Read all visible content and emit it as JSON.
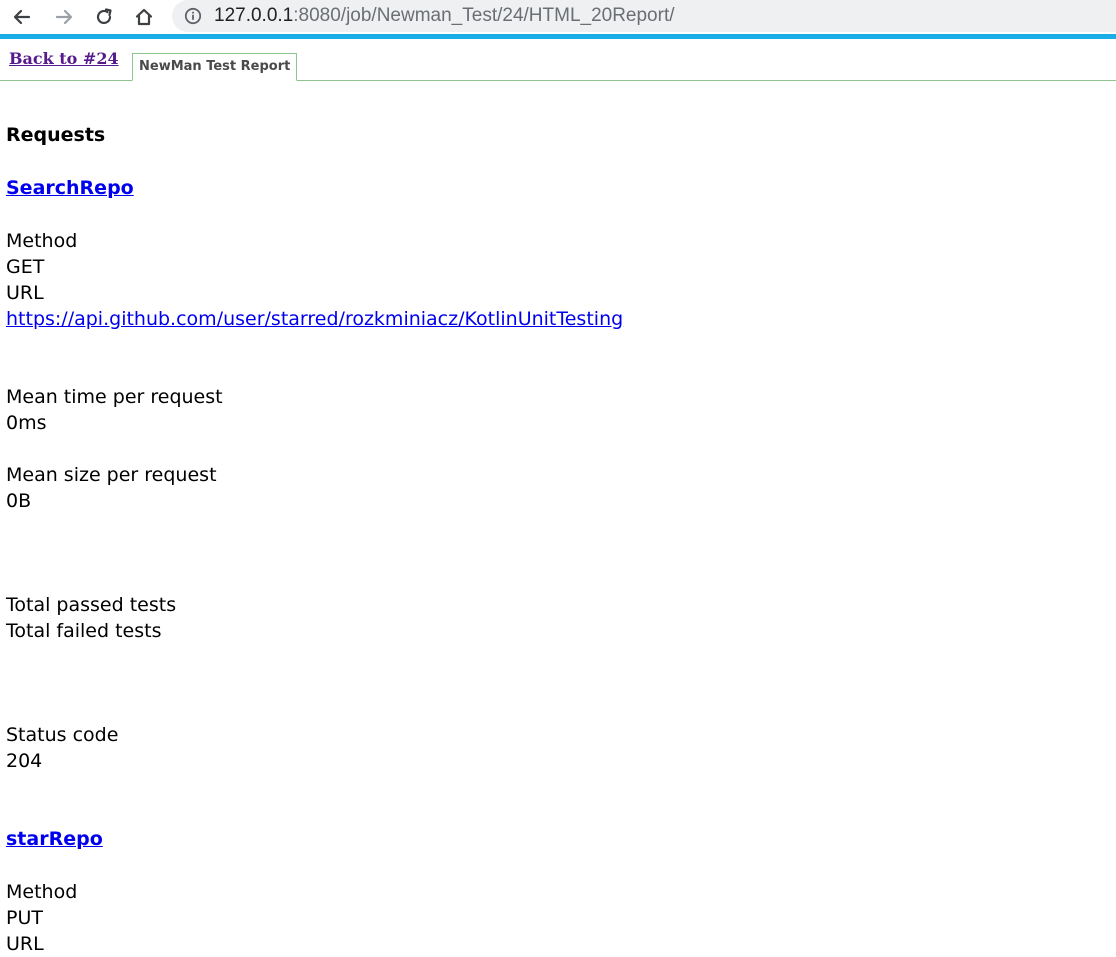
{
  "browser": {
    "url_host": "127.0.0.1",
    "url_rest": ":8080/job/Newman_Test/24/HTML_20Report/",
    "icons": [
      "back-arrow-icon",
      "forward-arrow-icon",
      "reload-icon",
      "home-icon",
      "info-icon"
    ]
  },
  "report_header": {
    "back_link": "Back to #24",
    "tab_label": "NewMan Test Report"
  },
  "report": {
    "section_title": "Requests",
    "requests": [
      {
        "name": "SearchRepo",
        "method_label": "Method",
        "method": "GET",
        "url_label": "URL",
        "url": "https://api.github.com/user/starred/rozkminiacz/KotlinUnitTesting",
        "mean_time_label": "Mean time per request",
        "mean_time": "0ms",
        "mean_size_label": "Mean size per request",
        "mean_size": "0B",
        "passed_label": "Total passed tests",
        "failed_label": "Total failed tests",
        "status_label": "Status code",
        "status_code": "204"
      },
      {
        "name": "starRepo",
        "method_label": "Method",
        "method": "PUT",
        "url_label": "URL"
      }
    ]
  },
  "colors": {
    "accent_bar": "#1aaee6",
    "visited_link": "#551a8b",
    "link": "#0000ee",
    "tab_border": "#8dc68d"
  }
}
